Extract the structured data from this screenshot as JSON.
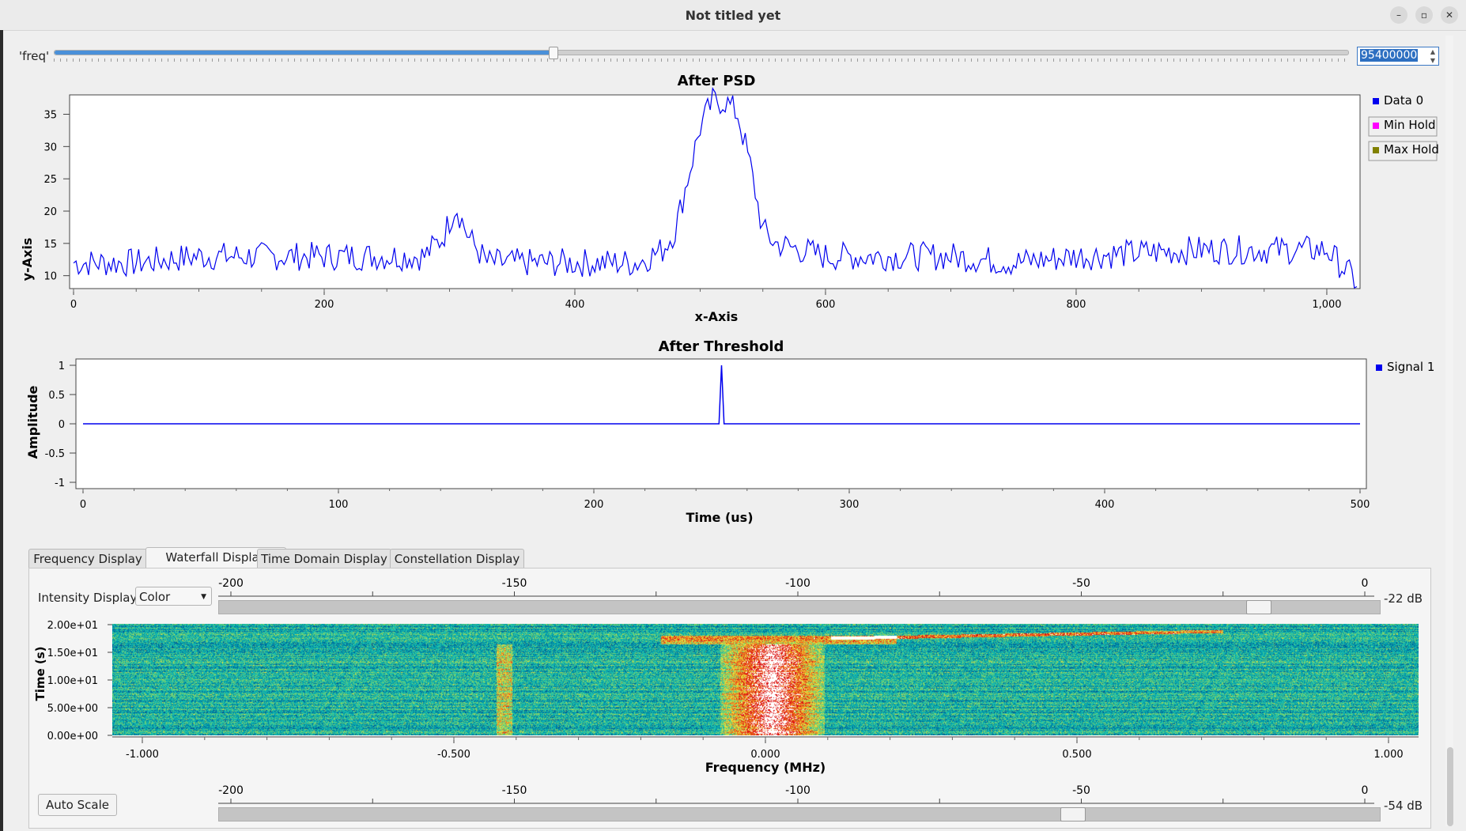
{
  "window": {
    "title": "Not titled yet"
  },
  "freq_control": {
    "label": "'freq'",
    "value": "95400000",
    "slider_fraction": 0.385
  },
  "psd": {
    "title": "After PSD",
    "xlabel": "x-Axis",
    "ylabel": "y-Axis",
    "x_ticks": [
      "0",
      "200",
      "400",
      "600",
      "800",
      "1,000"
    ],
    "y_ticks": [
      "10",
      "15",
      "20",
      "25",
      "30",
      "35"
    ],
    "legend": [
      "Data 0",
      "Min Hold",
      "Max Hold"
    ]
  },
  "threshold": {
    "title": "After Threshold",
    "xlabel": "Time (us)",
    "ylabel": "Amplitude",
    "x_ticks": [
      "0",
      "100",
      "200",
      "300",
      "400",
      "500"
    ],
    "y_ticks": [
      "1",
      "0.5",
      "0",
      "-0.5",
      "-1"
    ],
    "legend": [
      "Signal 1"
    ]
  },
  "tabs": [
    "Frequency Display",
    "Waterfall Display",
    "Time Domain Display",
    "Constellation Display"
  ],
  "waterfall": {
    "intensity_label": "Intensity Display:",
    "intensity_value": "Color",
    "top_scale_ticks": [
      "-200",
      "-150",
      "-100",
      "-50",
      "0"
    ],
    "top_db": "-22 dB",
    "top_slider_fraction": 0.885,
    "bottom_scale_ticks": [
      "-200",
      "-150",
      "-100",
      "-50",
      "0"
    ],
    "bottom_db": "-54 dB",
    "bottom_slider_fraction": 0.725,
    "y_ticks": [
      "2.00e+01",
      "1.50e+01",
      "1.00e+01",
      "5.00e+00",
      "0.00e+00"
    ],
    "ylabel": "Time (s)",
    "x_ticks": [
      "-1.000",
      "-0.500",
      "0.000",
      "0.500",
      "1.000"
    ],
    "xlabel": "Frequency (MHz)",
    "auto_scale": "Auto Scale"
  },
  "colors": {
    "accent": "#2d6fc1",
    "trace": "#0000ee",
    "min_hold": "#ff00ff",
    "max_hold": "#808000"
  },
  "chart_data": [
    {
      "type": "line",
      "title": "After PSD",
      "xlabel": "x-Axis",
      "ylabel": "y-Axis",
      "xlim": [
        0,
        1024
      ],
      "ylim": [
        8,
        38
      ],
      "series": [
        {
          "name": "Data 0",
          "x": [
            0,
            50,
            100,
            150,
            200,
            250,
            280,
            295,
            305,
            315,
            330,
            400,
            450,
            470,
            480,
            490,
            500,
            510,
            520,
            530,
            540,
            550,
            560,
            600,
            700,
            750,
            800,
            900,
            1000,
            1024
          ],
          "y": [
            12,
            12,
            13,
            13,
            13,
            13,
            13,
            16,
            21,
            16,
            12,
            12,
            12,
            14,
            17,
            25,
            33,
            37,
            37,
            35,
            27,
            17,
            15,
            13,
            13,
            12,
            13,
            14,
            14,
            9
          ]
        }
      ]
    },
    {
      "type": "line",
      "title": "After Threshold",
      "xlabel": "Time (us)",
      "ylabel": "Amplitude",
      "xlim": [
        0,
        500
      ],
      "ylim": [
        -1,
        1
      ],
      "series": [
        {
          "name": "Signal 1",
          "x": [
            0,
            249,
            250,
            251,
            500
          ],
          "y": [
            0,
            0,
            1,
            0,
            0
          ]
        }
      ]
    }
  ]
}
